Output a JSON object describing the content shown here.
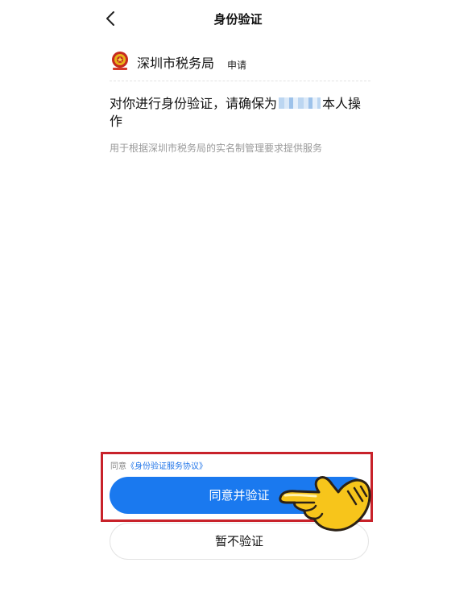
{
  "header": {
    "title": "身份验证",
    "back_icon": "chevron-left-icon"
  },
  "org": {
    "logo_icon": "tax-bureau-emblem-icon",
    "name": "深圳市税务局",
    "action": "申请"
  },
  "verify": {
    "prefix": "对你进行身份验证，请确保为",
    "suffix": "本人操作",
    "purpose": "用于根据深圳市税务局的实名制管理要求提供服务"
  },
  "footer": {
    "agree_prefix": "同意",
    "agreement_link": "《身份验证服务协议》",
    "confirm_label": "同意并验证",
    "decline_label": "暂不验证"
  },
  "colors": {
    "primary": "#1a79ef",
    "highlight": "#c8222a",
    "link": "#1e73e8"
  },
  "annotation_icon": "pointing-hand-icon"
}
